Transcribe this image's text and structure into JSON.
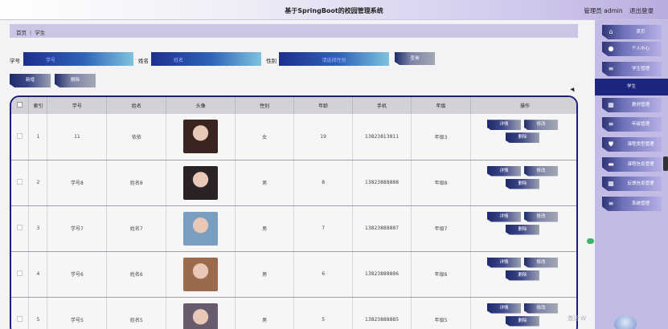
{
  "header": {
    "title": "基于SpringBoot的校园管理系统",
    "user": "管理员 admin",
    "logout": "退出登录"
  },
  "breadcrumb": {
    "home": "首页",
    "sep": "|",
    "current": "学生"
  },
  "search": {
    "xuehao_label": "学号",
    "xuehao_placeholder": "学号",
    "xingming_label": "姓名",
    "xingming_placeholder": "姓名",
    "xingbie_label": "性别",
    "xingbie_placeholder": "请选择性别",
    "search_btn": "查询"
  },
  "actions": {
    "add": "新增",
    "delete": "删除"
  },
  "table": {
    "headers": [
      "索引",
      "学号",
      "姓名",
      "头像",
      "性别",
      "年龄",
      "手机",
      "年级",
      "操作"
    ],
    "op_detail": "详情",
    "op_edit": "修改",
    "op_delete": "删除",
    "rows": [
      {
        "idx": "1",
        "xuehao": "11",
        "name": "依依",
        "gender": "女",
        "age": "19",
        "phone": "13823813811",
        "grade": "年级3",
        "avatar_bg": "#3a2420"
      },
      {
        "idx": "2",
        "xuehao": "学号8",
        "name": "姓名8",
        "gender": "男",
        "age": "8",
        "phone": "13823888888",
        "grade": "年级8",
        "avatar_bg": "#2a2226"
      },
      {
        "idx": "3",
        "xuehao": "学号7",
        "name": "姓名7",
        "gender": "男",
        "age": "7",
        "phone": "13823888887",
        "grade": "年级7",
        "avatar_bg": "#7a9ec0"
      },
      {
        "idx": "4",
        "xuehao": "学号6",
        "name": "姓名6",
        "gender": "男",
        "age": "6",
        "phone": "13823888886",
        "grade": "年级6",
        "avatar_bg": "#9a6a4c"
      },
      {
        "idx": "5",
        "xuehao": "学号5",
        "name": "姓名5",
        "gender": "男",
        "age": "5",
        "phone": "13823888885",
        "grade": "年级5",
        "avatar_bg": "#6a5a6e"
      }
    ]
  },
  "sidebar": {
    "items": [
      {
        "label": "首页",
        "icon": "home-icon"
      },
      {
        "label": "个人中心",
        "icon": "user-icon"
      },
      {
        "label": "学生管理",
        "icon": "menu-icon"
      },
      {
        "label": "学生",
        "icon": "",
        "active": true
      },
      {
        "label": "教师管理",
        "icon": "grid-icon"
      },
      {
        "label": "年级管理",
        "icon": "menu-icon"
      },
      {
        "label": "课程类型管理",
        "icon": "shield-icon"
      },
      {
        "label": "课程信息管理",
        "icon": "folder-icon"
      },
      {
        "label": "反馈信息管理",
        "icon": "grid-icon"
      },
      {
        "label": "系统管理",
        "icon": "menu-icon"
      }
    ]
  },
  "watermark": "激活 W",
  "colors": {
    "accent": "#1d257c",
    "sidebar": "#c2bbe6",
    "breadcrumb": "#cbc5e6"
  }
}
